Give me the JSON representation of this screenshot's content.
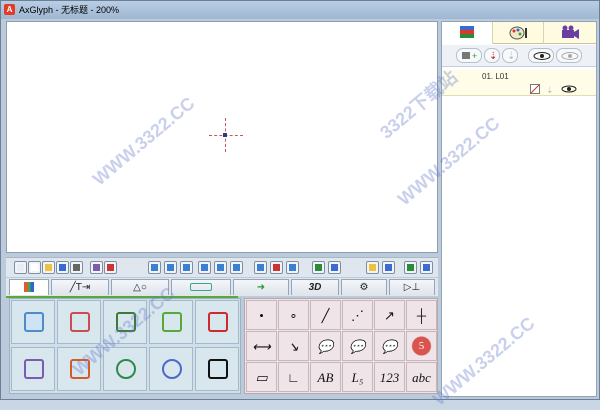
{
  "window": {
    "title": "AxGlyph - 无标题 - 200%",
    "app_icon": "A"
  },
  "toolbar": {
    "icons": [
      "new-menu-icon",
      "new-file-icon",
      "open-folder-icon",
      "save-icon",
      "settings-icon",
      "grid-icon",
      "align-left-icon",
      "align-center-icon",
      "align-right-icon",
      "align-top-icon",
      "align-middle-icon",
      "align-bottom-icon",
      "distribute-h-icon",
      "distribute-v-icon",
      "flip-icon",
      "group-icon",
      "ungroup-icon",
      "front-icon",
      "back-icon",
      "fit-icon"
    ]
  },
  "bottom_tabs": [
    {
      "label": "",
      "icon": "color-palette-icon",
      "active": true
    },
    {
      "label": "╱T⇥",
      "icon": "line-text-icon",
      "active": false
    },
    {
      "label": "△○",
      "icon": "shapes-icon",
      "active": false
    },
    {
      "label": "",
      "icon": "connector-icon",
      "active": false
    },
    {
      "label": "➜",
      "icon": "arrow-icon",
      "active": false
    },
    {
      "label": "3D",
      "icon": "3d-icon",
      "active": false
    },
    {
      "label": "⚙",
      "icon": "gear-tab-icon",
      "active": false
    },
    {
      "label": "▷⊥",
      "icon": "electric-icon",
      "active": false
    }
  ],
  "tool_palette": [
    {
      "icon": "image-icon",
      "color": "#4f8ac9"
    },
    {
      "icon": "wheel-icon",
      "color": "#c94f4f"
    },
    {
      "icon": "pen-icon",
      "color": "#3b7a3b"
    },
    {
      "icon": "cube-icon",
      "color": "#58a83a"
    },
    {
      "icon": "paint-bucket-icon",
      "color": "#cc2b2b"
    },
    {
      "icon": "function-graph-icon",
      "color": "#7a5bb0"
    },
    {
      "icon": "line-chart-icon",
      "color": "#d15c2b"
    },
    {
      "icon": "pie-chart-icon",
      "color": "#2f8a4a"
    },
    {
      "icon": "gauge-icon",
      "color": "#4a6ac9"
    },
    {
      "icon": "runner-icon",
      "color": "#111111"
    }
  ],
  "shape_palette": {
    "row1": [
      "•",
      "∘",
      "╱",
      "⋰",
      "↗",
      "┼"
    ],
    "row2": [
      "⟷",
      "↘",
      "💬",
      "💬",
      "💬",
      "5"
    ],
    "row3": [
      "▭",
      "∟",
      "AB",
      "L₅",
      "123",
      "abc"
    ]
  },
  "right_panel": {
    "tabs": [
      {
        "icon": "layers-icon",
        "active": true
      },
      {
        "icon": "palette-person-icon",
        "active": false
      },
      {
        "icon": "camera-icon",
        "active": false
      }
    ],
    "layer_name": "01. L01"
  },
  "watermarks": [
    "3322下载站",
    "WWW.3322.CC"
  ]
}
